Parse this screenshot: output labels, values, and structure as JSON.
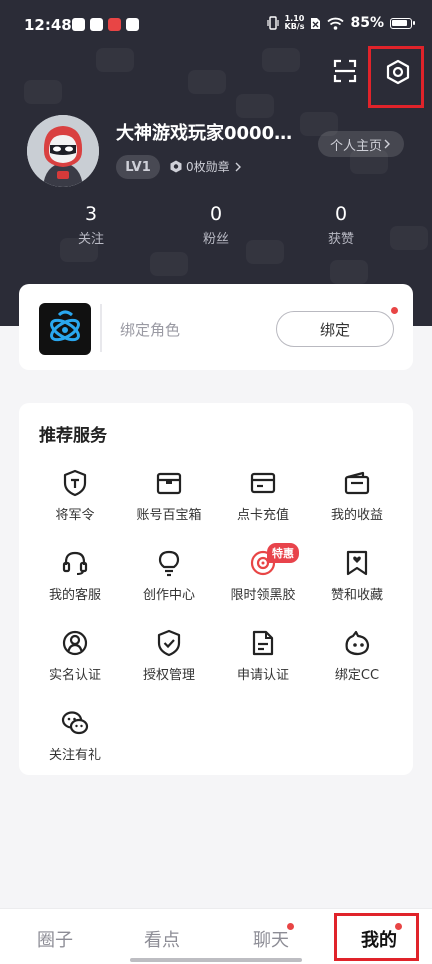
{
  "status_bar": {
    "time": "12:48",
    "net_speed_value": "1.10",
    "net_speed_unit": "KB/s",
    "battery_percent": "85%"
  },
  "header": {
    "scan_icon": "scan-icon",
    "settings_icon": "hexagon-settings-icon"
  },
  "profile": {
    "username": "大神游戏玩家0000…",
    "homepage_label": "个人主页",
    "level": "LV1",
    "medals": "0枚勋章",
    "stats": [
      {
        "value": "3",
        "label": "关注"
      },
      {
        "value": "0",
        "label": "粉丝"
      },
      {
        "value": "0",
        "label": "获赞"
      }
    ]
  },
  "bind_role": {
    "label": "绑定角色",
    "button_label": "绑定"
  },
  "services": {
    "title": "推荐服务",
    "items": [
      {
        "label": "将军令",
        "icon": "shield-t-icon"
      },
      {
        "label": "账号百宝箱",
        "icon": "treasure-box-icon"
      },
      {
        "label": "点卡充值",
        "icon": "card-icon"
      },
      {
        "label": "我的收益",
        "icon": "wallet-icon"
      },
      {
        "label": "我的客服",
        "icon": "headset-icon"
      },
      {
        "label": "创作中心",
        "icon": "lightbulb-icon"
      },
      {
        "label": "限时领黑胶",
        "icon": "vinyl-icon",
        "badge": "特惠"
      },
      {
        "label": "赞和收藏",
        "icon": "bookmark-heart-icon"
      },
      {
        "label": "实名认证",
        "icon": "user-circle-icon"
      },
      {
        "label": "授权管理",
        "icon": "shield-check-icon"
      },
      {
        "label": "申请认证",
        "icon": "document-icon"
      },
      {
        "label": "绑定CC",
        "icon": "cc-icon"
      },
      {
        "label": "关注有礼",
        "icon": "wechat-icon"
      }
    ]
  },
  "tabbar": {
    "tabs": [
      {
        "label": "圈子"
      },
      {
        "label": "看点"
      },
      {
        "label": "聊天"
      },
      {
        "label": "我的"
      }
    ],
    "active": "我的"
  },
  "colors": {
    "header_bg": "#2b2c37",
    "accent_red": "#e84545",
    "highlight_box": "#e0232a"
  }
}
